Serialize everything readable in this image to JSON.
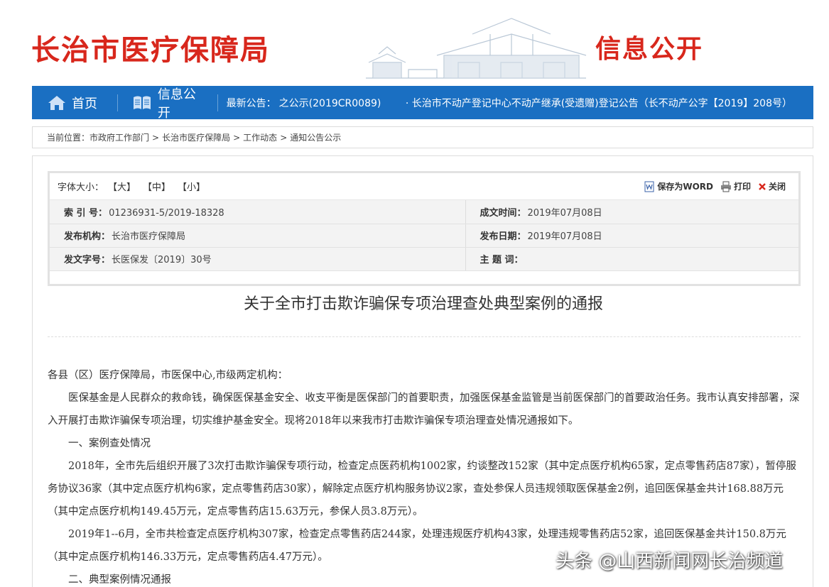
{
  "header": {
    "site_title": "长治市医疗保障局",
    "section_title": "信息公开"
  },
  "nav": {
    "home": "首页",
    "info": "信息公开",
    "news_label": "最新公告：",
    "news_items": [
      "之公示(2019CR0089)",
      "· 长治市不动产登记中心不动产继承(受遗赠)登记公告（长不动产公字【2019】208号）"
    ]
  },
  "breadcrumb": {
    "label": "当前位置：",
    "items": [
      "市政府工作部门",
      "长治市医疗保障局",
      "工作动态",
      "通知公告公示"
    ],
    "separator": ">"
  },
  "toolbar": {
    "font_size_label": "字体大小：",
    "sizes": [
      "【大】",
      "【中】",
      "【小】"
    ],
    "save_word": "保存为WORD",
    "print": "打印",
    "close": "关闭"
  },
  "meta": {
    "index_key": "索 引 号：",
    "index_val": "01236931-5/2019-18328",
    "created_key": "成文时间：",
    "created_val": "2019年07月08日",
    "org_key": "发布机构：",
    "org_val": "长治市医疗保障局",
    "pub_key": "发布日期：",
    "pub_val": "2019年07月08日",
    "docno_key": "发文字号：",
    "docno_val": "长医保发〔2019〕30号",
    "subject_key": "主 题 词：",
    "subject_val": ""
  },
  "document": {
    "title": "关于全市打击欺诈骗保专项治理查处典型案例的通报",
    "paragraphs": [
      "各县（区）医疗保障局，市医保中心,市级两定机构：",
      "医保基金是人民群众的救命钱，确保医保基金安全、收支平衡是医保部门的首要职责，加强医保基金监管是当前医保部门的首要政治任务。我市认真安排部署，深入开展打击欺诈骗保专项治理，切实维护基金安全。现将2018年以来我市打击欺诈骗保专项治理查处情况通报如下。",
      "一、案例查处情况",
      "2018年，全市先后组织开展了3次打击欺诈骗保专项行动，检查定点医药机构1002家，约谈整改152家（其中定点医疗机构65家，定点零售药店87家），暂停服务协议36家（其中定点医疗机构6家，定点零售药店30家），解除定点医疗机构服务协议2家，查处参保人员违规领取医保基金2例，追回医保基金共计168.88万元（其中定点医疗机构149.45万元，定点零售药店15.63万元，参保人员3.8万元）。",
      "2019年1--6月，全市共检查定点医疗机构307家，检查定点零售药店244家，处理违规医疗机构43家，处理违规零售药店52家，追回医保基金共计150.8万元（其中定点医疗机构146.33万元，定点零售药店4.47万元）。",
      "二、典型案例情况通报"
    ]
  },
  "watermark": "头条 @山西新闻网长治频道",
  "colors": {
    "brand_red": "#d8271c",
    "nav_blue": "#1a6fc2"
  }
}
